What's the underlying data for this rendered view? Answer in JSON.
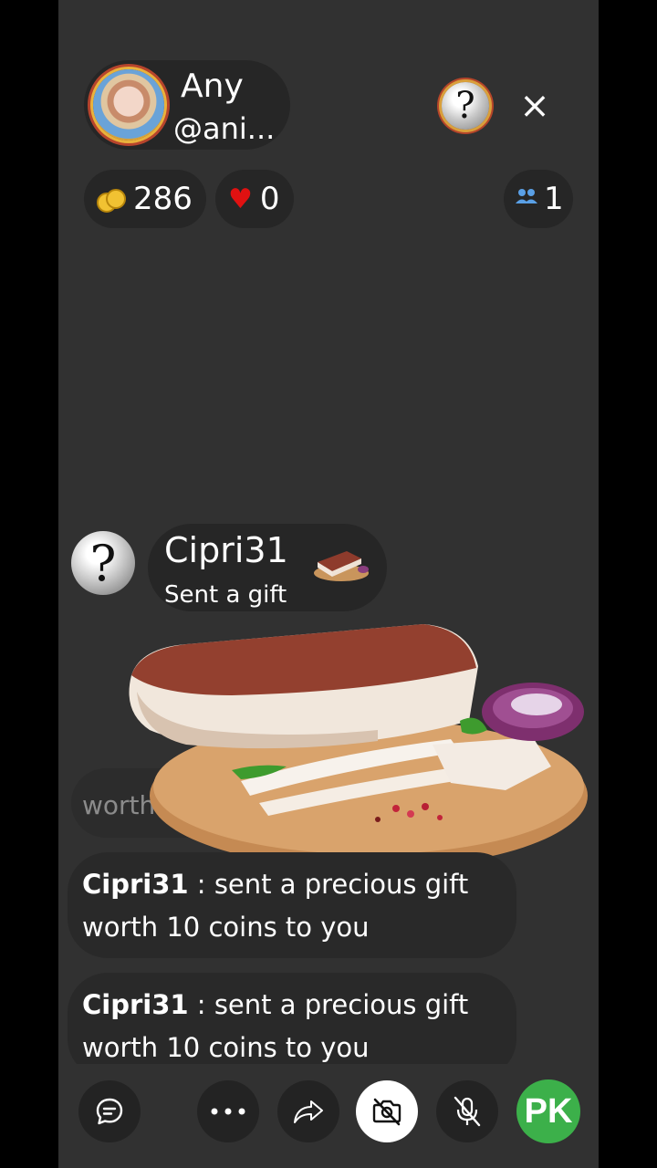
{
  "host": {
    "name": "Any",
    "handle": "@ani..."
  },
  "stats": {
    "coins": "286",
    "hearts": "0",
    "viewers": "1"
  },
  "icons": {
    "close": "×",
    "question": "?"
  },
  "gift_notice": {
    "user": "Cipri31",
    "action": "Sent a gift",
    "faded_text": "worth 20 coins to you"
  },
  "chat": [
    {
      "user": "Cipri31",
      "separator": " : ",
      "message_line1": "sent a precious gift",
      "message_line2": "worth 10 coins to you"
    },
    {
      "user": "Cipri31",
      "separator": " : ",
      "message_line1": "sent a precious gift",
      "message_line2": "worth 10 coins to you"
    }
  ],
  "bottom_bar": {
    "more": "• • •",
    "pk": "PK"
  },
  "colors": {
    "background": "#313131",
    "pill": "#262626",
    "pk_green": "#3cb04a",
    "heart_red": "#e01111",
    "coin_gold": "#f1c232"
  }
}
